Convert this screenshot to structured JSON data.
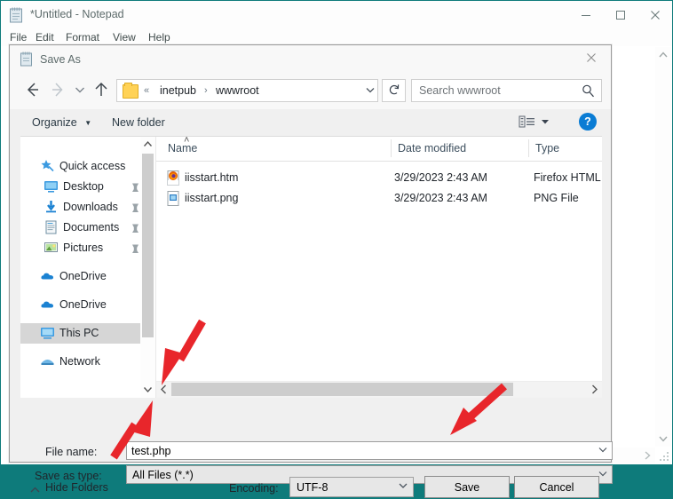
{
  "notepad": {
    "title": "*Untitled - Notepad",
    "icon": "notepad-icon",
    "menu": [
      {
        "label": "File"
      },
      {
        "label": "Edit"
      },
      {
        "label": "Format"
      },
      {
        "label": "View"
      },
      {
        "label": "Help"
      }
    ],
    "window_controls": [
      {
        "name": "minimize-button",
        "icon": "minimize-icon"
      },
      {
        "name": "maximize-button",
        "icon": "maximize-icon"
      },
      {
        "name": "close-button",
        "icon": "close-icon"
      }
    ]
  },
  "dialog": {
    "title": "Save As",
    "icon": "notepad-icon",
    "close_icon": "close-icon",
    "nav": {
      "back_icon": "arrow-left-icon",
      "forward_icon": "arrow-right-icon",
      "recent_icon": "chevron-down-icon",
      "up_icon": "arrow-up-icon"
    },
    "address": {
      "folder_icon": "folder-icon",
      "overflow": "«",
      "crumbs": [
        "inetpub",
        "wwwroot"
      ],
      "separator": "›",
      "dropdown_icon": "chevron-down-icon"
    },
    "refresh_icon": "refresh-icon",
    "search": {
      "placeholder": "Search wwwroot",
      "icon": "search-icon"
    },
    "commandbar": {
      "organize": "Organize",
      "organize_caret": "▼",
      "new_folder": "New folder",
      "view_options_icon": "view-options-icon",
      "view_caret": "▼",
      "help_label": "?"
    },
    "navpane": {
      "items": [
        {
          "label": "Quick access",
          "icon": "star-pin-icon",
          "pinned": false,
          "child": false,
          "selected": false
        },
        {
          "label": "Desktop",
          "icon": "desktop-icon",
          "pinned": true,
          "child": true,
          "selected": false
        },
        {
          "label": "Downloads",
          "icon": "downloads-icon",
          "pinned": true,
          "child": true,
          "selected": false
        },
        {
          "label": "Documents",
          "icon": "documents-icon",
          "pinned": true,
          "child": true,
          "selected": false
        },
        {
          "label": "Pictures",
          "icon": "pictures-icon",
          "pinned": true,
          "child": true,
          "selected": false
        },
        {
          "label": "OneDrive",
          "icon": "onedrive-icon",
          "pinned": false,
          "child": false,
          "selected": false
        },
        {
          "label": "OneDrive",
          "icon": "onedrive-icon",
          "pinned": false,
          "child": false,
          "selected": false
        },
        {
          "label": "This PC",
          "icon": "this-pc-icon",
          "pinned": false,
          "child": false,
          "selected": true
        },
        {
          "label": "Network",
          "icon": "network-icon",
          "pinned": false,
          "child": false,
          "selected": false
        }
      ],
      "scroll_up_icon": "chevron-up-icon",
      "scroll_down_icon": "chevron-down-icon"
    },
    "filelist": {
      "columns": [
        "Name",
        "Date modified",
        "Type"
      ],
      "sort_indicator": "˄",
      "rows": [
        {
          "name": "iisstart.htm",
          "date": "3/29/2023 2:43 AM",
          "type": "Firefox HTML Do",
          "icon": "firefox-html-file-icon"
        },
        {
          "name": "iisstart.png",
          "date": "3/29/2023 2:43 AM",
          "type": "PNG File",
          "icon": "png-file-icon"
        }
      ],
      "scroll_left_icon": "chevron-left-icon",
      "scroll_right_icon": "chevron-right-icon"
    },
    "form": {
      "filename_label": "File name:",
      "filename_value": "test.php",
      "filename_dropdown_icon": "chevron-down-icon",
      "savetype_label": "Save as type:",
      "savetype_value": "All Files  (*.*)",
      "savetype_dropdown_icon": "chevron-down-icon",
      "hide_folders_label": "Hide Folders",
      "hide_folders_icon": "chevron-up-icon",
      "encoding_label": "Encoding:",
      "encoding_value": "UTF-8",
      "encoding_dropdown_icon": "chevron-down-icon",
      "save_label": "Save",
      "cancel_label": "Cancel"
    }
  },
  "annotations": {
    "color": "#e8262b",
    "arrows": [
      {
        "name": "arrow-to-filename-field",
        "target": "File name input"
      },
      {
        "name": "arrow-to-save-as-type",
        "target": "Save as type combo"
      },
      {
        "name": "arrow-to-save-button",
        "target": "Save button"
      }
    ]
  },
  "colors": {
    "desktop": "#0e7b7b",
    "accent_blue": "#0a7cd4",
    "annotation_red": "#e8262b",
    "selected_row": "#d6d6d6"
  }
}
